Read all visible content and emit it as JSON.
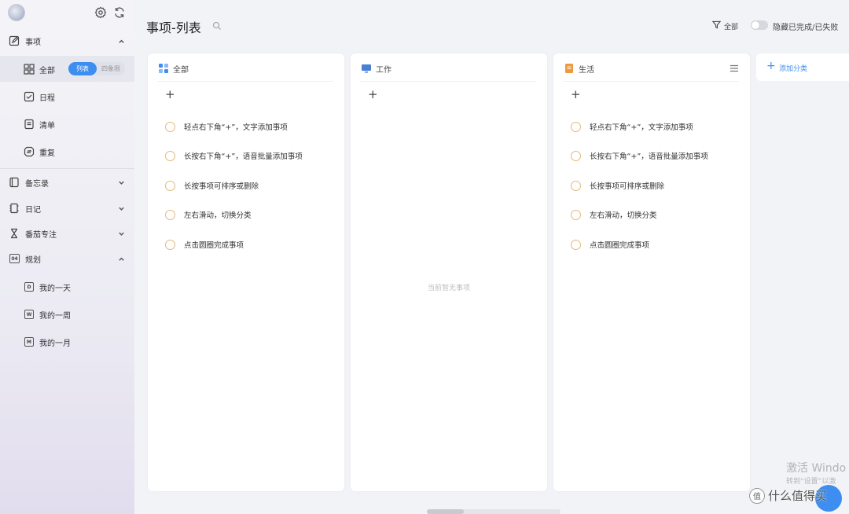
{
  "sidebar": {
    "items": [
      {
        "label": "事项"
      },
      {
        "label": "全部"
      },
      {
        "label": "日程"
      },
      {
        "label": "清单"
      },
      {
        "label": "重复"
      },
      {
        "label": "备忘录"
      },
      {
        "label": "日记"
      },
      {
        "label": "番茄专注"
      },
      {
        "label": "规划"
      },
      {
        "label": "我的一天",
        "badge": "D"
      },
      {
        "label": "我的一周",
        "badge": "W"
      },
      {
        "label": "我的一月",
        "badge": "M"
      }
    ],
    "plan_icon_text": "04",
    "view_toggle": {
      "list": "列表",
      "quadrant": "四象限"
    }
  },
  "header": {
    "title": "事项-列表",
    "filter_label": "全部",
    "hide_label": "隐藏已完成/已失败"
  },
  "columns": [
    {
      "title": "全部",
      "tasks": [
        "轻点右下角“+”，文字添加事项",
        "长按右下角“+”，语音批量添加事项",
        "长按事项可排序或删除",
        "左右滑动，切换分类",
        "点击圆圈完成事项"
      ]
    },
    {
      "title": "工作",
      "tasks": [],
      "empty_text": "当前暂无事项"
    },
    {
      "title": "生活",
      "tasks": [
        "轻点右下角“+”，文字添加事项",
        "长按右下角“+”，语音批量添加事项",
        "长按事项可排序或删除",
        "左右滑动，切换分类",
        "点击圆圈完成事项"
      ]
    }
  ],
  "add_category": "添加分类",
  "overlay": {
    "watermark_line1": "激活 Windo",
    "watermark_line2": "转到“设置”以激",
    "brand": "什么值得买",
    "brand_logo": "值"
  },
  "colors": {
    "accent": "#3d8ef0",
    "task_circle": "#e4b77a",
    "icon_all": "#3d8ef0",
    "icon_work": "#4a7fd6",
    "icon_life": "#ef9a3a"
  }
}
